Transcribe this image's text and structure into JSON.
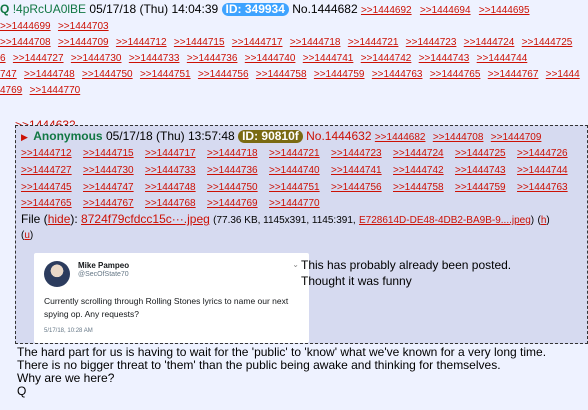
{
  "op": {
    "name": "Q",
    "trip": "!4pRcUA0lBE",
    "date": "05/17/18 (Thu) 14:04:39",
    "id_label": "ID: 349934",
    "id_color": "#3ea3ff",
    "post_no": "No.1444682",
    "backlinks_row1": [
      ">>1444692",
      ">>1444694",
      ">>1444695"
    ],
    "backlinks_row2": [
      ">>1444699",
      ">>1444703"
    ],
    "backlinks_row3": [
      ">>1444708",
      ">>1444709",
      ">>1444712",
      ">>1444715",
      ">>1444717",
      ">>1444718",
      ">>1444721",
      ">>1444723",
      ">>1444724",
      ">>1444725"
    ],
    "backlinks_row4": [
      "6",
      ">>1444727",
      ">>1444730",
      ">>1444733",
      ">>1444736",
      ">>1444740",
      ">>1444741",
      ">>1444742",
      ">>1444743",
      ">>1444744"
    ],
    "backlinks_row5": [
      "747",
      ">>1444748",
      ">>1444750",
      ">>1444751",
      ">>1444756",
      ">>1444758",
      ">>1444759",
      ">>1444763",
      ">>1444765",
      ">>1444767",
      ">>1444"
    ],
    "backlinks_row6": [
      "4769",
      ">>1444770"
    ],
    "quote_ref": ">>1444632",
    "body_lines": [
      "The hard part for us is having to wait for the 'public' to 'know' what we've known for a very long time.",
      "There is no bigger threat to 'them' than the public being awake and thinking for themselves.",
      "Why are we here?",
      "Q"
    ]
  },
  "reply": {
    "name": "Anonymous",
    "date": "05/17/18 (Thu) 13:57:48",
    "id_label": "ID: 90810f",
    "id_color": "#7a6a12",
    "post_no": "No.1444632",
    "backlinks": [
      ">>1444682",
      ">>1444708",
      ">>1444709",
      ">>1444712",
      ">>1444715",
      ">>1444717",
      ">>1444718",
      ">>1444721",
      ">>1444723",
      ">>1444724",
      ">>1444725",
      ">>1444726",
      ">>1444727",
      ">>1444730",
      ">>1444733",
      ">>1444736",
      ">>1444740",
      ">>1444741",
      ">>1444742",
      ">>1444743",
      ">>1444744",
      ">>1444745",
      ">>1444747",
      ">>1444748",
      ">>1444750",
      ">>1444751",
      ">>1444756",
      ">>1444758",
      ">>1444759",
      ">>1444763",
      ">>1444765",
      ">>1444767",
      ">>1444768",
      ">>1444769",
      ">>1444770"
    ],
    "file_label": "File",
    "hide_label": "hide",
    "file_name": "8724f79cfdcc15c···.jpeg",
    "file_meta": "(77.36 KB, 1145x391, 1145:391,",
    "file_orig": "E728614D-DE48-4DB2-BA9B-9....jpeg",
    "file_h": "h",
    "file_u": "u",
    "tweet": {
      "name": "Mike Pampeo",
      "handle": "@SecOfState70",
      "text": "Currently scrolling through Rolling Stones lyrics to name our next spying op. Any requests?",
      "time": "5/17/18, 10:28 AM"
    },
    "comment_lines": [
      "This has probably already been posted.",
      "Thought it was funny"
    ]
  }
}
